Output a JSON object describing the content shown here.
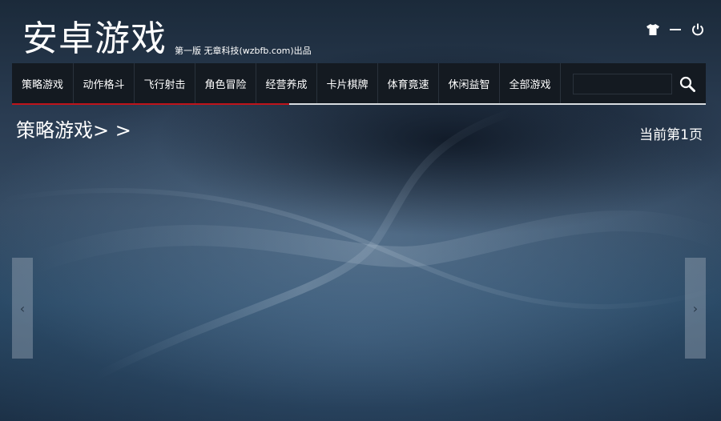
{
  "header": {
    "brand": "安卓游戏",
    "subtitle": "第一版 无章科技(wzbfb.com)出品"
  },
  "window_controls": {
    "skin_icon": "shirt-icon",
    "minimize_icon": "minimize-icon",
    "power_icon": "power-icon"
  },
  "nav": {
    "items": [
      {
        "label": "策略游戏"
      },
      {
        "label": "动作格斗"
      },
      {
        "label": "飞行射击"
      },
      {
        "label": "角色冒险"
      },
      {
        "label": "经营养成"
      },
      {
        "label": "卡片棋牌"
      },
      {
        "label": "体育竟速"
      },
      {
        "label": "休闲益智"
      },
      {
        "label": "全部游戏"
      }
    ],
    "search": {
      "value": "",
      "placeholder": ""
    },
    "active_color": "#c0141b"
  },
  "main": {
    "section_title": "策略游戏> >",
    "page_indicator": "当前第1页"
  },
  "carousel": {
    "prev_glyph": "‹",
    "next_glyph": "›"
  }
}
